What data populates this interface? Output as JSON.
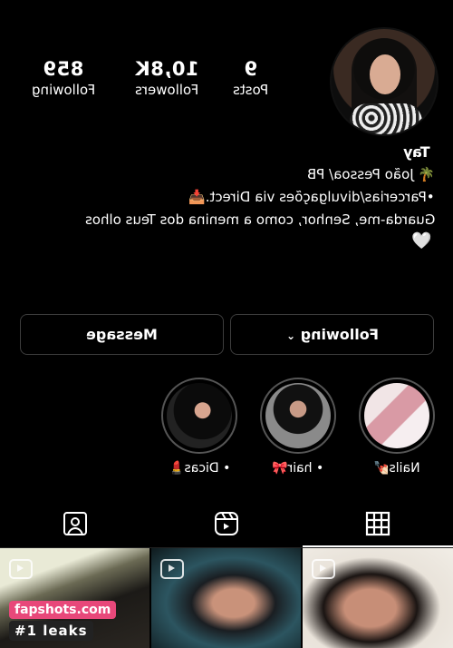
{
  "profile": {
    "stats": [
      {
        "value": "859",
        "label": "Following"
      },
      {
        "value": "10,8K",
        "label": "Followers"
      },
      {
        "value": "9",
        "label": "Posts"
      }
    ],
    "name": "Tay",
    "bio": [
      "🌴 João Pessoa/ PB",
      "•Parcerias/divulgações via Direct.📥",
      "Guarda-me, Senhor, como a menina dos Teus olhos",
      "🤍"
    ]
  },
  "actions": {
    "following_label": "Following",
    "message_label": "Message"
  },
  "highlights": [
    {
      "label": "Nails💅🏻"
    },
    {
      "label": "• hair🎀"
    },
    {
      "label": "• Dicas💄"
    }
  ],
  "tabs": {
    "icons": [
      "grid-icon",
      "reels-icon",
      "tagged-icon"
    ],
    "active": "grid"
  },
  "watermark": {
    "site": "fapshots.com",
    "tag": "#1 leaks"
  }
}
